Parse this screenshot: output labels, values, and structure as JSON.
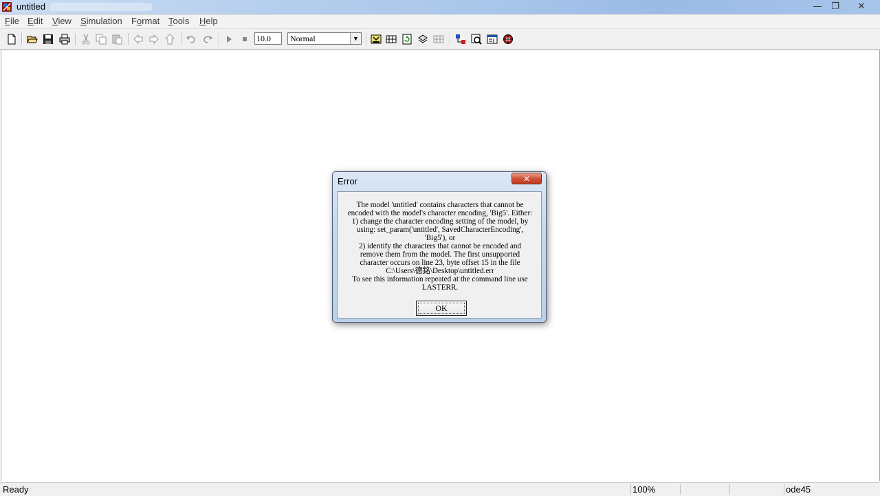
{
  "window": {
    "title": "untitled",
    "controls": {
      "minimize": "—",
      "restore": "❐",
      "close": "✕"
    }
  },
  "menubar": {
    "items": [
      {
        "label": "File",
        "accel": "F"
      },
      {
        "label": "Edit",
        "accel": "E"
      },
      {
        "label": "View",
        "accel": "V"
      },
      {
        "label": "Simulation",
        "accel": "S"
      },
      {
        "label": "Format",
        "accel": "o"
      },
      {
        "label": "Tools",
        "accel": "T"
      },
      {
        "label": "Help",
        "accel": "H"
      }
    ]
  },
  "toolbar": {
    "stop_time": "10.0",
    "sim_mode": "Normal",
    "icons": [
      "new-file-icon",
      "open-folder-icon",
      "save-icon",
      "print-icon",
      "cut-icon",
      "copy-icon",
      "paste-icon",
      "back-arrow-icon",
      "forward-arrow-icon",
      "up-arrow-icon",
      "undo-icon",
      "redo-icon",
      "play-icon",
      "stop-icon",
      "build-icon",
      "update-diagram-icon",
      "refresh-icon",
      "debug-icon",
      "grid-icon",
      "library-browser-icon",
      "model-explorer-icon",
      "model-browser-icon",
      "debugger-icon"
    ]
  },
  "dialog": {
    "title": "Error",
    "close_label": "✕",
    "message_lines": [
      "The model 'untitled' contains characters that cannot be",
      "encoded with the model's character encoding, 'Big5'. Either:",
      "1) change the character encoding setting of the model, by",
      "using: set_param('untitled', SavedCharacterEncoding',",
      "'Big5'), or",
      "2) identify the characters that cannot be encoded and",
      "remove them from the model. The first unsupported",
      "character occurs on line 23, byte offset 15 in the file",
      "C:\\Users\\德銘\\Desktop\\untitled.err",
      "To see this information repeated at the command line use",
      "LASTERR."
    ],
    "ok_label": "OK"
  },
  "statusbar": {
    "status": "Ready",
    "zoom": "100%",
    "cell3": "",
    "cell4": "",
    "solver": "ode45"
  }
}
